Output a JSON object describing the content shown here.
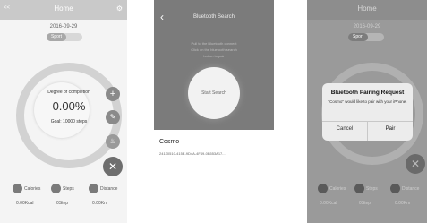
{
  "screen1": {
    "title": "Home",
    "back_label": "<< ",
    "date": "2016-09-29",
    "toggle_label": "Sport",
    "ring_label": "Degree of completion",
    "percent": "0.00%",
    "goal": "Goal: 10000 steps",
    "stats": [
      {
        "name": "Calories",
        "value": "0.00Kcal"
      },
      {
        "name": "Steps",
        "value": "0Step"
      },
      {
        "name": "Distance",
        "value": "0.00Km"
      }
    ]
  },
  "screen2": {
    "title": "Bluetooth Search",
    "hint_line1": "Pull to the Bluetooth connect",
    "hint_line2": "Click on the bluetooth search",
    "hint_line3": "button to pair",
    "search_button": "Start Search",
    "device_name": "Cosmo",
    "device_uuid": "24130510-415E-9D4A-4F49-0B553A17..."
  },
  "screen3": {
    "title": "Home",
    "date": "2016-09-29",
    "toggle_label": "Sport",
    "dialog_title": "Bluetooth Pairing Request",
    "dialog_message": "\"Cosmo\" would like to pair with your iPhone.",
    "cancel_label": "Cancel",
    "pair_label": "Pair",
    "stats": [
      {
        "name": "Calories",
        "value": "0.00Kcal"
      },
      {
        "name": "Steps",
        "value": "0Step"
      },
      {
        "name": "Distance",
        "value": "0.00Km"
      }
    ]
  },
  "colors": {
    "topbar": "#c9c9c9",
    "ring": "#d2d2d2",
    "fab": "#8a8a8a",
    "dim": "#7b7b7b"
  },
  "icons": [
    "plus-icon",
    "pencil-icon",
    "flame-icon",
    "close-icon",
    "back-arrow-icon",
    "gear-icon"
  ]
}
